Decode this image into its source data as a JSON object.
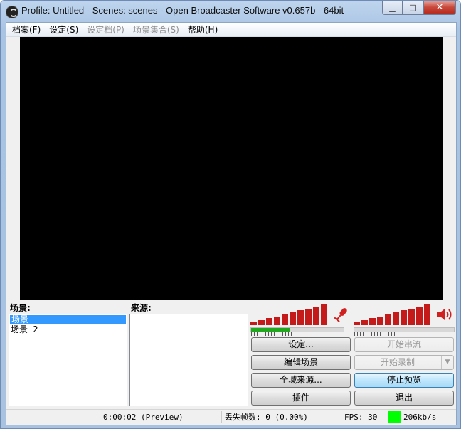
{
  "window": {
    "title": "Profile: Untitled - Scenes: scenes - Open Broadcaster Software v0.657b - 64bit",
    "minimize_glyph": "▁",
    "maximize_glyph": "□",
    "close_glyph": "✕"
  },
  "menu": {
    "items": [
      {
        "label": "档案(F)",
        "enabled": true
      },
      {
        "label": "设定(S)",
        "enabled": true
      },
      {
        "label": "设定档(P)",
        "enabled": false
      },
      {
        "label": "场景集合(S)",
        "enabled": false
      },
      {
        "label": "帮助(H)",
        "enabled": true
      }
    ]
  },
  "scenes": {
    "label": "场景:",
    "items": [
      {
        "label": "场景",
        "selected": true
      },
      {
        "label": "场景 2",
        "selected": false
      }
    ]
  },
  "sources": {
    "label": "来源:"
  },
  "audio": {
    "mic_icon": "microphone-icon",
    "speaker_icon": "speaker-icon",
    "mic_level": 0.42,
    "desktop_level": 0.0,
    "colors": {
      "bars": "#c41a1a",
      "level": "#22a81e"
    }
  },
  "buttons": {
    "settings": "设定...",
    "start_stream": "开始串流",
    "edit_scene": "编辑场景",
    "start_record": "开始录制",
    "global_sources": "全域来源...",
    "stop_preview": "停止预览",
    "plugins": "插件",
    "exit": "退出"
  },
  "status": {
    "time": "0:00:02 (Preview)",
    "dropped_frames": "丢失帧数: 0 (0.00%)",
    "fps": "FPS: 30",
    "bitrate": "206kb/s",
    "bitrate_color": "#00ff00"
  }
}
